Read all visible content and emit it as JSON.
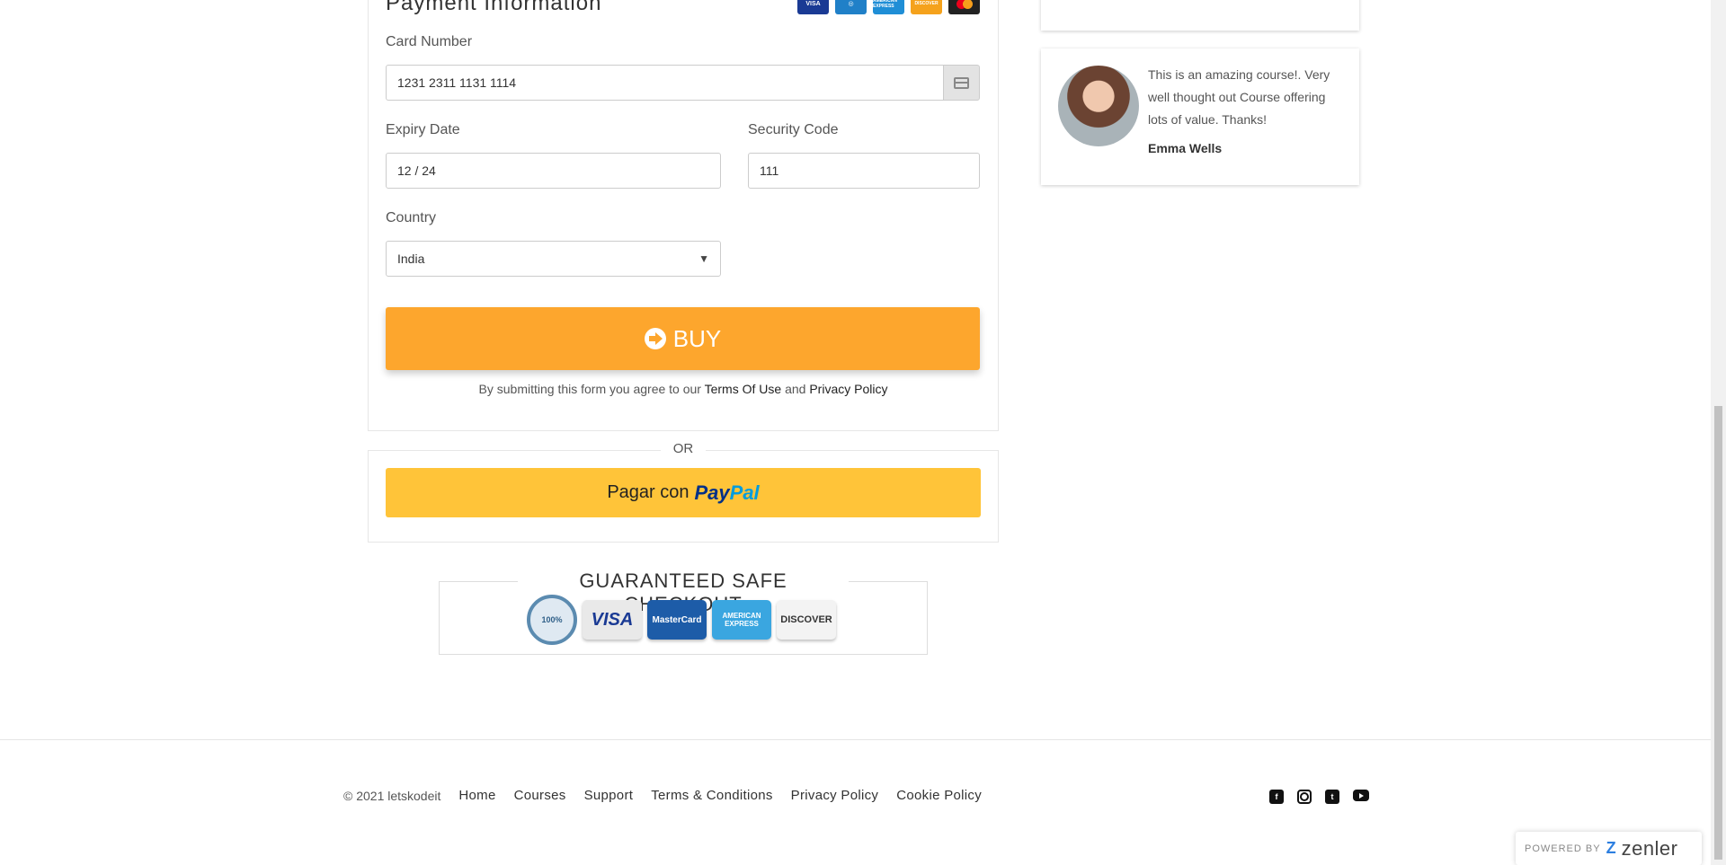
{
  "payment": {
    "title": "Payment Information",
    "card_logos": [
      {
        "icon": "visa-logo",
        "text": "VISA",
        "color": "#1a3a94"
      },
      {
        "icon": "diners-logo",
        "text": "",
        "color": "#2080c8"
      },
      {
        "icon": "amex-logo",
        "text": "AMERICAN EXPRESS",
        "color": "#1f8ed6"
      },
      {
        "icon": "discover-logo",
        "text": "DISCOVER",
        "color": "#f5a21c"
      },
      {
        "icon": "mastercard-logo",
        "text": "",
        "color": "#222222"
      }
    ],
    "card_number_label": "Card Number",
    "card_number_value": "1231 2311 1131 1114",
    "expiry_label": "Expiry Date",
    "expiry_value": "12 / 24",
    "security_label": "Security Code",
    "security_value": "111",
    "country_label": "Country",
    "country_value": "India",
    "buy_label": "BUY",
    "agree_prefix": "By submitting this form you agree to our ",
    "terms_link": "Terms Of Use",
    "agree_and": " and ",
    "privacy_link": "Privacy Policy"
  },
  "or_text": "OR",
  "paypal": {
    "prefix": "Pagar con",
    "logo_part1": "Pay",
    "logo_part2": "Pal"
  },
  "safe_checkout": {
    "title": "GUARANTEED SAFE CHECKOUT",
    "seal_text": "100%",
    "cards": [
      {
        "icon": "visa-card-icon",
        "text": "VISA",
        "bg": "#e9e9e9",
        "fg": "#1a3a94"
      },
      {
        "icon": "mastercard-card-icon",
        "text": "MasterCard",
        "bg": "#1d5ca8",
        "fg": "#ffffff"
      },
      {
        "icon": "amex-card-icon",
        "text": "AMERICAN EXPRESS",
        "bg": "#3aa6e0",
        "fg": "#ffffff"
      },
      {
        "icon": "discover-card-icon",
        "text": "DISCOVER",
        "bg": "#f3f3f3",
        "fg": "#333333"
      }
    ]
  },
  "testimonial": {
    "text": "This is an amazing course!. Very well thought out Course offering lots of value. Thanks!",
    "name": "Emma Wells"
  },
  "footer": {
    "copyright": "© 2021 letskodeit",
    "links": [
      "Home",
      "Courses",
      "Support",
      "Terms & Conditions",
      "Privacy Policy",
      "Cookie Policy"
    ],
    "social": [
      "facebook-icon",
      "instagram-icon",
      "twitter-icon",
      "youtube-icon"
    ]
  },
  "powered_by": {
    "label": "POWERED BY",
    "brand": "zenler"
  },
  "colors": {
    "buy_button": "#fda62d",
    "paypal_button": "#ffc439"
  }
}
